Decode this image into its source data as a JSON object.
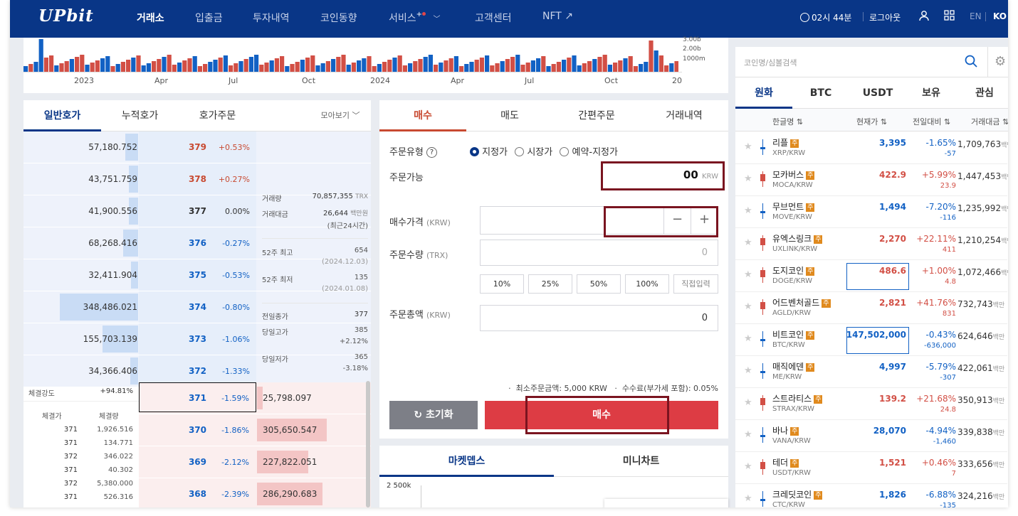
{
  "header": {
    "logo": "UPbit",
    "nav": [
      "거래소",
      "입출금",
      "투자내역",
      "코인동향",
      "서비스",
      "고객센터",
      "NFT ↗"
    ],
    "time": "02시 44분",
    "logout": "로그아웃",
    "lang_en": "EN",
    "lang_ko": "KO"
  },
  "chart": {
    "volume_ticks": [
      "3.00b",
      "2.00b",
      "1000m"
    ],
    "x_ticks": [
      "2023",
      "Apr",
      "Jul",
      "Oct",
      "2024",
      "Apr",
      "Jul",
      "Oct",
      "20"
    ]
  },
  "orderbook": {
    "tabs": [
      "일반호가",
      "누적호가",
      "호가주문"
    ],
    "group_label": "모아보기",
    "asks": [
      {
        "vol": "57,180.752",
        "price": "379",
        "rate": "+0.53%",
        "tone": "red",
        "fill": 0.16
      },
      {
        "vol": "43,751.759",
        "price": "378",
        "rate": "+0.27%",
        "tone": "red",
        "fill": 0.12
      },
      {
        "vol": "41,900.556",
        "price": "377",
        "rate": "0.00%",
        "tone": "dark",
        "fill": 0.12
      },
      {
        "vol": "68,268.416",
        "price": "376",
        "rate": "-0.27%",
        "tone": "blue",
        "fill": 0.19
      },
      {
        "vol": "32,411.904",
        "price": "375",
        "rate": "-0.53%",
        "tone": "blue",
        "fill": 0.09
      },
      {
        "vol": "348,486.021",
        "price": "374",
        "rate": "-0.80%",
        "tone": "blue",
        "fill": 1.0
      },
      {
        "vol": "155,703.139",
        "price": "373",
        "rate": "-1.06%",
        "tone": "blue",
        "fill": 0.45
      },
      {
        "vol": "34,366.406",
        "price": "372",
        "rate": "-1.33%",
        "tone": "blue",
        "fill": 0.1
      }
    ],
    "bids": [
      {
        "price": "371",
        "rate": "-1.59%",
        "vol": "25,798.097",
        "fill": 0.07
      },
      {
        "price": "370",
        "rate": "-1.86%",
        "vol": "305,650.547",
        "fill": 0.85
      },
      {
        "price": "369",
        "rate": "-2.12%",
        "vol": "227,822.051",
        "fill": 0.63
      },
      {
        "price": "368",
        "rate": "-2.39%",
        "vol": "286,290.683",
        "fill": 0.8
      }
    ],
    "stats": {
      "vol_label": "거래량",
      "vol_value": "70,857,355",
      "vol_unit": "TRX",
      "amt_label": "거래대금",
      "amt_value": "26,644",
      "amt_unit": "백만원",
      "amt_note": "(최근24시간)",
      "high52_label": "52주 최고",
      "high52_value": "654",
      "high52_date": "(2024.12.03)",
      "low52_label": "52주 최저",
      "low52_value": "135",
      "low52_date": "(2024.01.08)",
      "prev_label": "전일종가",
      "prev_value": "377",
      "dhigh_label": "당일고가",
      "dhigh_value": "385",
      "dhigh_rate": "+2.12%",
      "dlow_label": "당일저가",
      "dlow_value": "365",
      "dlow_rate": "-3.18%"
    },
    "strength_label": "체결강도",
    "strength_value": "+94.81%",
    "trade_headers": [
      "체결가",
      "체결량"
    ],
    "trades": [
      {
        "price": "371",
        "qty": "1,926.516",
        "tone": "blue"
      },
      {
        "price": "371",
        "qty": "134.771",
        "tone": "blue"
      },
      {
        "price": "372",
        "qty": "346.022",
        "tone": "red"
      },
      {
        "price": "371",
        "qty": "40.302",
        "tone": "blue"
      },
      {
        "price": "372",
        "qty": "5,380.000",
        "tone": "red"
      },
      {
        "price": "371",
        "qty": "526.316",
        "tone": "blue"
      }
    ]
  },
  "order": {
    "tabs": [
      "매수",
      "매도",
      "간편주문",
      "거래내역"
    ],
    "type_label": "주문유형",
    "types": [
      "지정가",
      "시장가",
      "예약-지정가"
    ],
    "avail_label": "주문가능",
    "avail_value": "00",
    "avail_unit": "KRW",
    "price_label": "매수가격",
    "price_unit": "(KRW)",
    "qty_label": "주문수량",
    "qty_unit": "(TRX)",
    "qty_value": "0",
    "pcts": [
      "10%",
      "25%",
      "50%",
      "100%",
      "직접입력"
    ],
    "total_label": "주문총액",
    "total_unit": "(KRW)",
    "total_value": "0",
    "min_note": "최소주문금액: 5,000 KRW",
    "fee_note": "수수료(부가세 포함): 0.05%",
    "reset": "초기화",
    "buy": "매수"
  },
  "depth": {
    "tabs": [
      "마켓뎁스",
      "미니차트"
    ],
    "y_tick": "2 500k"
  },
  "market": {
    "search_placeholder": "코인명/심볼검색",
    "tabs": [
      "원화",
      "BTC",
      "USDT",
      "보유",
      "관심"
    ],
    "cols": [
      "한글명",
      "현재가",
      "전일대비",
      "거래대금"
    ],
    "badge": "주",
    "unit": "백만",
    "coins": [
      {
        "name": "리플",
        "sym": "XRP/KRW",
        "price": "3,395",
        "rate": "-1.65%",
        "diff": "-57",
        "amt": "1,709,763",
        "tone": "blue",
        "box": false
      },
      {
        "name": "모카버스",
        "sym": "MOCA/KRW",
        "price": "422.9",
        "rate": "+5.99%",
        "diff": "23.9",
        "amt": "1,447,453",
        "tone": "red",
        "box": false
      },
      {
        "name": "무브먼트",
        "sym": "MOVE/KRW",
        "price": "1,494",
        "rate": "-7.20%",
        "diff": "-116",
        "amt": "1,235,992",
        "tone": "blue",
        "box": false
      },
      {
        "name": "유엑스링크",
        "sym": "UXLINK/KRW",
        "price": "2,270",
        "rate": "+22.11%",
        "diff": "411",
        "amt": "1,210,254",
        "tone": "red",
        "box": false
      },
      {
        "name": "도지코인",
        "sym": "DOGE/KRW",
        "price": "486.6",
        "rate": "+1.00%",
        "diff": "4.8",
        "amt": "1,072,466",
        "tone": "red",
        "box": true
      },
      {
        "name": "어드벤처골드",
        "sym": "AGLD/KRW",
        "price": "2,821",
        "rate": "+41.76%",
        "diff": "831",
        "amt": "732,743",
        "tone": "red",
        "box": false
      },
      {
        "name": "비트코인",
        "sym": "BTC/KRW",
        "price": "147,502,000",
        "rate": "-0.43%",
        "diff": "-636,000",
        "amt": "624,646",
        "tone": "blue",
        "box": true
      },
      {
        "name": "매직에덴",
        "sym": "ME/KRW",
        "price": "4,997",
        "rate": "-5.79%",
        "diff": "-307",
        "amt": "422,061",
        "tone": "blue",
        "box": false
      },
      {
        "name": "스트라티스",
        "sym": "STRAX/KRW",
        "price": "139.2",
        "rate": "+21.68%",
        "diff": "24.8",
        "amt": "350,913",
        "tone": "red",
        "box": false
      },
      {
        "name": "바나",
        "sym": "VANA/KRW",
        "price": "28,070",
        "rate": "-4.94%",
        "diff": "-1,460",
        "amt": "339,838",
        "tone": "blue",
        "box": false
      },
      {
        "name": "테더",
        "sym": "USDT/KRW",
        "price": "1,521",
        "rate": "+0.46%",
        "diff": "7",
        "amt": "333,656",
        "tone": "red",
        "box": false
      },
      {
        "name": "크레딧코인",
        "sym": "CTC/KRW",
        "price": "1,826",
        "rate": "-6.88%",
        "diff": "-135",
        "amt": "324,216",
        "tone": "blue",
        "box": false
      }
    ]
  }
}
